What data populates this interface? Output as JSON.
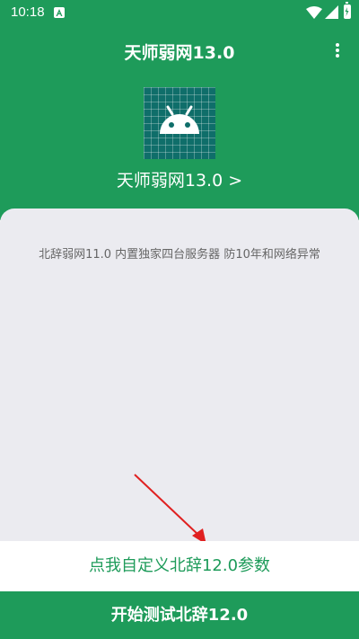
{
  "status_bar": {
    "time": "10:18"
  },
  "colors": {
    "brand_green": "#1e9b5a",
    "icon_teal": "#0f6e6a",
    "card_background": "#ebebf0",
    "arrow_red": "#e02020"
  },
  "header": {
    "title": "天师弱网13.0",
    "menu_icon": "more-vert-icon"
  },
  "app": {
    "icon": "android-icon",
    "name_link": "天师弱网13.0 >"
  },
  "card": {
    "description": "北辞弱网11.0 内置独家四台服务器 防10年和网络异常"
  },
  "actions": {
    "custom_params_label": "点我自定义北辞12.0参数",
    "start_label": "开始测试北辞12.0"
  }
}
